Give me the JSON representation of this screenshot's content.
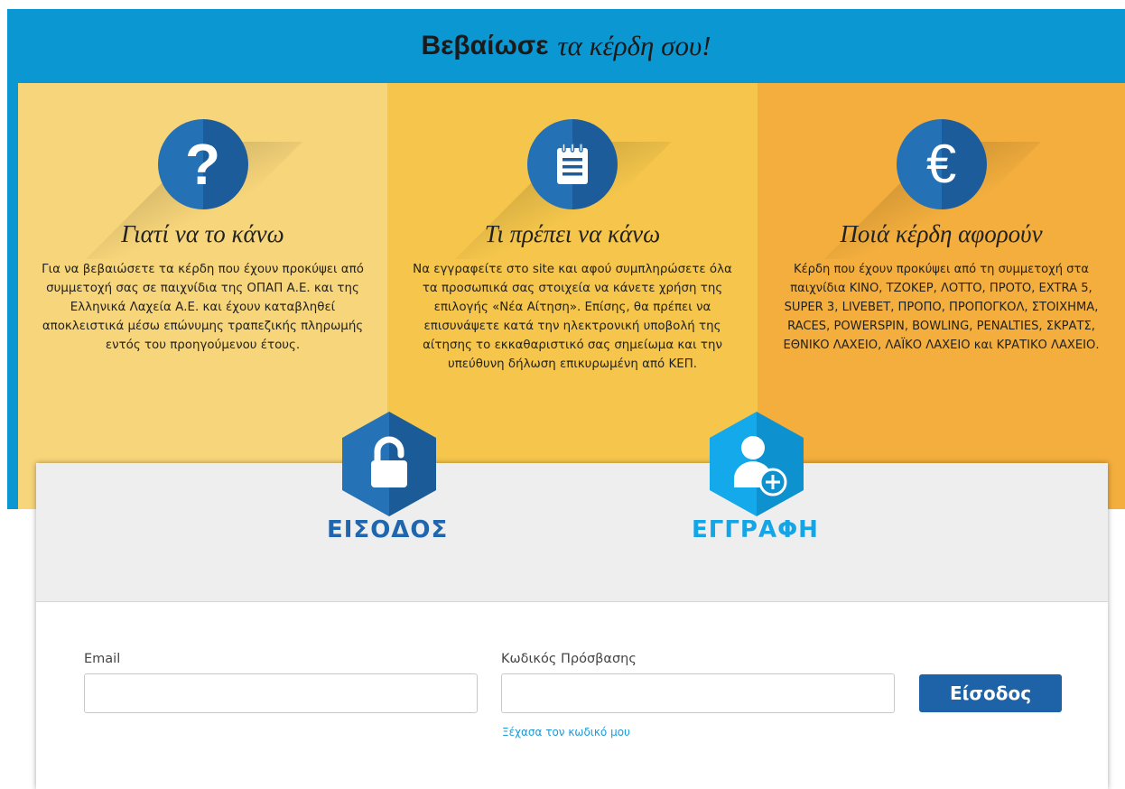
{
  "header": {
    "title_bold": "Βεβαίωσε",
    "title_light": "τα κέρδη σου!"
  },
  "columns": [
    {
      "icon": "question-icon",
      "title": "Γιατί να το κάνω",
      "text": "Για να βεβαιώσετε τα κέρδη που έχουν προκύψει από συμμετοχή σας σε παιχνίδια της ΟΠΑΠ Α.Ε. και της Ελληνικά Λαχεία Α.Ε. και έχουν καταβληθεί αποκλειστικά μέσω επώνυμης τραπεζικής πληρωμής εντός του προηγούμενου έτους."
    },
    {
      "icon": "document-icon",
      "title": "Τι πρέπει να κάνω",
      "text": "Να εγγραφείτε στο site και αφού συμπληρώσετε όλα τα προσωπικά σας στοιχεία να κάνετε χρήση της επιλογής «Νέα Αίτηση». Επίσης, θα πρέπει να επισυνάψετε κατά την ηλεκτρονική υποβολή της αίτησης το εκκαθαριστικό σας σημείωμα και την υπεύθυνη δήλωση επικυρωμένη από ΚΕΠ."
    },
    {
      "icon": "euro-icon",
      "title": "Ποιά κέρδη αφορούν",
      "text": "Κέρδη που έχουν προκύψει από τη συμμετοχή στα παιχνίδια ΚΙΝΟ, ΤΖΟΚΕΡ, ΛΟΤΤΟ, ΠΡΟΤΟ, EXTRA 5, SUPER 3, LIVEBET, ΠΡΟΠΟ, ΠΡΟΠΟΓΚΟΛ, ΣΤΟΙΧΗΜΑ, RACES, POWERSPIN, BOWLING, PENALTIES, ΣΚΡΑΤΣ, ΕΘΝΙΚΟ ΛΑΧΕΙΟ, ΛΑΪΚΟ ΛΑΧΕΙΟ και ΚΡΑΤΙΚΟ ΛΑΧΕΙΟ."
    }
  ],
  "tabs": {
    "login": "ΕΙΣΟΔΟΣ",
    "register": "ΕΓΓΡΑΦΗ"
  },
  "login_form": {
    "email_label": "Email",
    "email_value": "",
    "password_label": "Κωδικός Πρόσβασης",
    "password_value": "",
    "submit_label": "Είσοδος",
    "forgot_link": "Ξέχασα τον κωδικό μου"
  },
  "colors": {
    "header_bg": "#0b97d2",
    "column_1": "#f7d57a",
    "column_2": "#f5c64b",
    "column_3": "#f3ae3d",
    "primary_blue": "#1e63a7",
    "light_blue": "#14a5e6"
  }
}
